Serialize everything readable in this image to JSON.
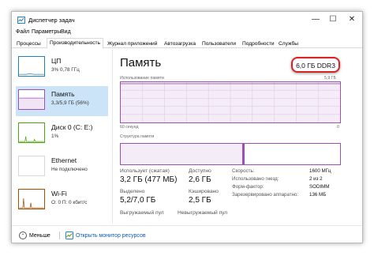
{
  "window": {
    "title": "Диспетчер задач",
    "controls": {
      "minimize": "—",
      "maximize": "☐",
      "close": "✕"
    }
  },
  "menu": [
    "Файл",
    "Параметры",
    "Вид"
  ],
  "tabs": [
    {
      "label": "Процессы",
      "active": false
    },
    {
      "label": "Производительность",
      "active": true
    },
    {
      "label": "Журнал приложений",
      "active": false
    },
    {
      "label": "Автозагрузка",
      "active": false
    },
    {
      "label": "Пользователи",
      "active": false
    },
    {
      "label": "Подробности",
      "active": false
    },
    {
      "label": "Службы",
      "active": false
    }
  ],
  "sidebar": [
    {
      "title": "ЦП",
      "subtitle": "3% 0,78 ГГц",
      "color": "#1e7ec8",
      "active": false
    },
    {
      "title": "Память",
      "subtitle": "3,3/5,9 ГБ (56%)",
      "color": "#9c4fb5",
      "active": true
    },
    {
      "title": "Диск 0 (C: E:)",
      "subtitle": "1%",
      "color": "#4da60c",
      "active": false
    },
    {
      "title": "Ethernet",
      "subtitle": "Не подключено",
      "color": "#a74f01",
      "active": false
    },
    {
      "title": "Wi-Fi",
      "subtitle": "О: 0 П: 0 кбит/с",
      "color": "#a74f01",
      "active": false
    }
  ],
  "main": {
    "title": "Память",
    "ram_type": "6,0 ГБ DDR3",
    "usage_label": "Использование памяти",
    "usage_max": "5,9 ГБ",
    "graph_time": "60 секунд",
    "graph_min": "0",
    "structure_label": "Структура памяти"
  },
  "stats": {
    "in_use_label": "Использует (сжатая)",
    "in_use_value": "3,2 ГБ (477 МБ)",
    "available_label": "Доступно",
    "available_value": "2,6 ГБ",
    "committed_label": "Выделено",
    "committed_value": "5,2/7,0 ГБ",
    "cached_label": "Кэшировано",
    "cached_value": "2,5 ГБ",
    "paged_label": "Выгружаемый пул",
    "nonpaged_label": "Невыгружаемый пул"
  },
  "info": [
    {
      "label": "Скорость:",
      "value": "1600 МГц"
    },
    {
      "label": "Использовано гнезд:",
      "value": "2 из 2"
    },
    {
      "label": "Форм-фактор:",
      "value": "SODIMM"
    },
    {
      "label": "Зарезервировано аппаратно:",
      "value": "136 МБ"
    }
  ],
  "footer": {
    "less_label": "Меньше",
    "monitor_label": "Открыть монитор ресурсов"
  },
  "colors": {
    "memory_accent": "#9c4fb5",
    "selection": "#cce4f7",
    "highlight_box": "#dd2222",
    "link": "#0a58b4"
  }
}
